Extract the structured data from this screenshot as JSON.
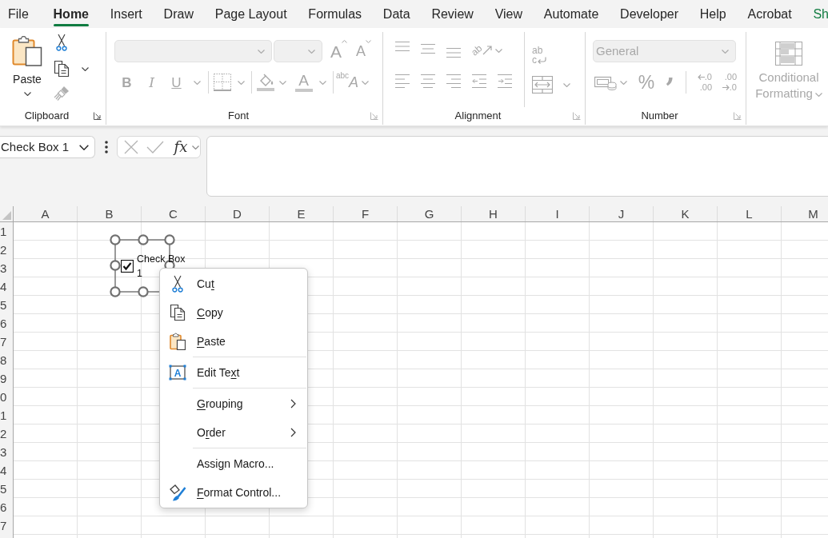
{
  "tabs": [
    {
      "label": "File",
      "kind": "standard",
      "selected": false
    },
    {
      "label": "Home",
      "kind": "standard",
      "selected": true
    },
    {
      "label": "Insert",
      "kind": "standard",
      "selected": false
    },
    {
      "label": "Draw",
      "kind": "standard",
      "selected": false
    },
    {
      "label": "Page Layout",
      "kind": "standard",
      "selected": false
    },
    {
      "label": "Formulas",
      "kind": "standard",
      "selected": false
    },
    {
      "label": "Data",
      "kind": "standard",
      "selected": false
    },
    {
      "label": "Review",
      "kind": "standard",
      "selected": false
    },
    {
      "label": "View",
      "kind": "standard",
      "selected": false
    },
    {
      "label": "Automate",
      "kind": "standard",
      "selected": false
    },
    {
      "label": "Developer",
      "kind": "standard",
      "selected": false
    },
    {
      "label": "Help",
      "kind": "standard",
      "selected": false
    },
    {
      "label": "Acrobat",
      "kind": "standard",
      "selected": false
    },
    {
      "label": "Sh",
      "kind": "contextual",
      "selected": false
    }
  ],
  "ribbon": {
    "clipboard": {
      "label": "Clipboard",
      "paste": "Paste"
    },
    "font": {
      "label": "Font",
      "disabled": true,
      "grow_font": "A",
      "shrink_font": "A",
      "bold": "B",
      "italic": "I",
      "underline": "U",
      "font_color": "A",
      "phonetic_guide": "$^{abc}$A"
    },
    "alignment": {
      "label": "Alignment",
      "disabled": true,
      "orientation": "ab",
      "wrap_text": [
        "ab",
        "c"
      ]
    },
    "number": {
      "label": "Number",
      "disabled": true,
      "format": "General",
      "percent": "%",
      "comma": ",",
      "increase_decimal": [
        ".0",
        ".00"
      ],
      "decrease_decimal": [
        ".00",
        ".0"
      ]
    },
    "styles": {
      "disabled": true,
      "conditional_formatting": "Conditional Formatting"
    }
  },
  "formula_bar": {
    "name_box": "Check Box 1",
    "insert_function": "fx"
  },
  "sheet": {
    "columns": [
      "A",
      "B",
      "C",
      "D",
      "E",
      "F",
      "G",
      "H",
      "I",
      "J",
      "K",
      "L",
      "M"
    ],
    "rows": [
      "1",
      "2",
      "3",
      "4",
      "5",
      "6",
      "7",
      "8",
      "9",
      "0",
      "1",
      "2",
      "3",
      "4",
      "5",
      "6",
      "7"
    ]
  },
  "checkbox_control": {
    "label": "Check Box 1",
    "checked": true,
    "selected": true
  },
  "context_menu": {
    "sections": [
      {
        "items": [
          {
            "kind": "cut",
            "before": "Cu",
            "key": "t"
          },
          {
            "kind": "copy",
            "key": "C",
            "after": "opy"
          },
          {
            "kind": "paste",
            "key": "P",
            "after": "aste"
          }
        ]
      },
      {
        "items": [
          {
            "kind": "edit",
            "glyph": "A",
            "before": "Edit Te",
            "key": "x",
            "after": "t"
          }
        ]
      },
      {
        "items": [
          {
            "kind": "submenu",
            "key": "G",
            "after": "rouping"
          },
          {
            "kind": "submenu",
            "before": "O",
            "key": "r",
            "after": "der"
          }
        ]
      },
      {
        "items": [
          {
            "kind": "plain",
            "before": "Assi",
            "key": "g",
            "after": "n Macro..."
          },
          {
            "kind": "format",
            "key": "F",
            "after": "ormat Control..."
          }
        ]
      }
    ]
  }
}
